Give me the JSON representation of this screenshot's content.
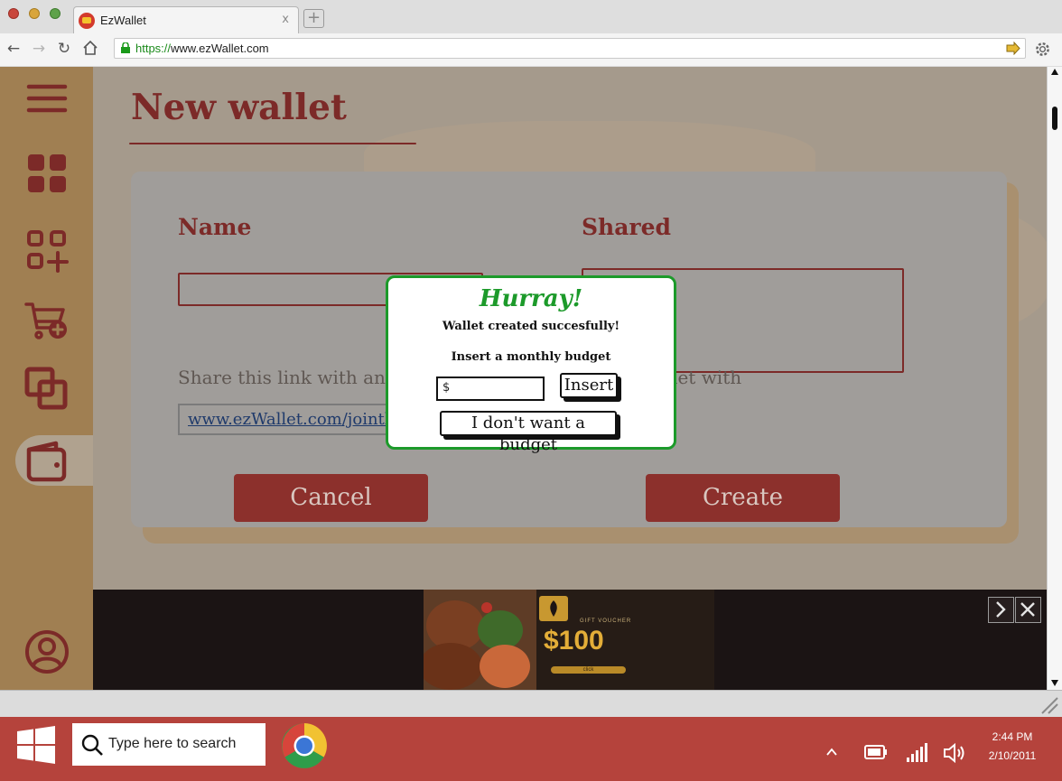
{
  "browser": {
    "tab_title": "EzWallet",
    "tab_close": "x",
    "url_scheme": "https://",
    "url_rest": "www.ezWallet.com"
  },
  "page": {
    "title": "New wallet",
    "name_label": "Name",
    "shared_label": "Shared",
    "share_text": "Share this link with anyone you want to share the wallet with",
    "share_link": "www.ezWallet.com/jointhiswallet",
    "cancel_label": "Cancel",
    "create_label": "Create"
  },
  "sidebar": {
    "items": [
      "menu",
      "dashboard",
      "add-widget",
      "add-to-cart",
      "copy",
      "wallet",
      "profile"
    ],
    "active": "wallet"
  },
  "ad": {
    "gift_text": "GIFT VOUCHER",
    "price": "$100",
    "cta": "click"
  },
  "modal": {
    "title": "Hurray!",
    "message": "Wallet created succesfully!",
    "prompt": "Insert a monthly budget",
    "budget_prefix": "$",
    "insert_label": "Insert",
    "skip_label": "I don't want a budget"
  },
  "taskbar": {
    "search_placeholder": "Type here to search",
    "time": "2:44 PM",
    "date": "2/10/2011"
  },
  "colors": {
    "accent": "#7c2a28",
    "sidebar": "#a07f52",
    "success": "#1c9a2a",
    "taskbar": "#b5433c"
  }
}
